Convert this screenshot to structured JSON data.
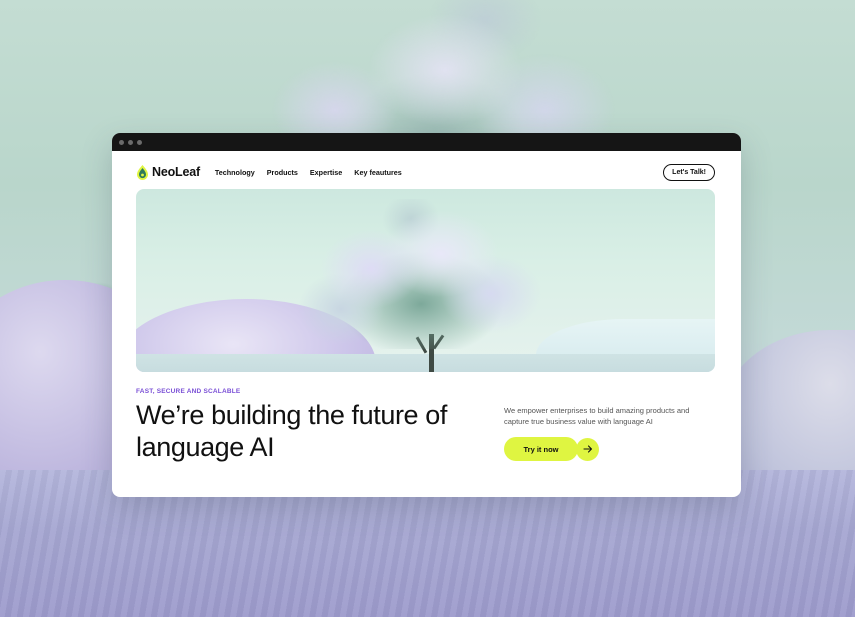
{
  "nav": {
    "brand": "NeoLeaf",
    "links": [
      "Technology",
      "Products",
      "Expertise",
      "Key feautures"
    ],
    "cta": "Let's Talk!"
  },
  "hero": {
    "eyebrow": "FAST, SECURE AND SCALABLE",
    "headline": "We’re building the future of language AI",
    "description": "We empower enterprises to build amazing products and capture true business value with language AI",
    "cta": "Try it now"
  },
  "colors": {
    "accent": "#dff541",
    "eyebrow": "#7a4fd6",
    "titlebar": "#151515"
  },
  "icons": {
    "logo": "leaf-drop-icon",
    "cta_arrow": "arrow-right-icon"
  }
}
